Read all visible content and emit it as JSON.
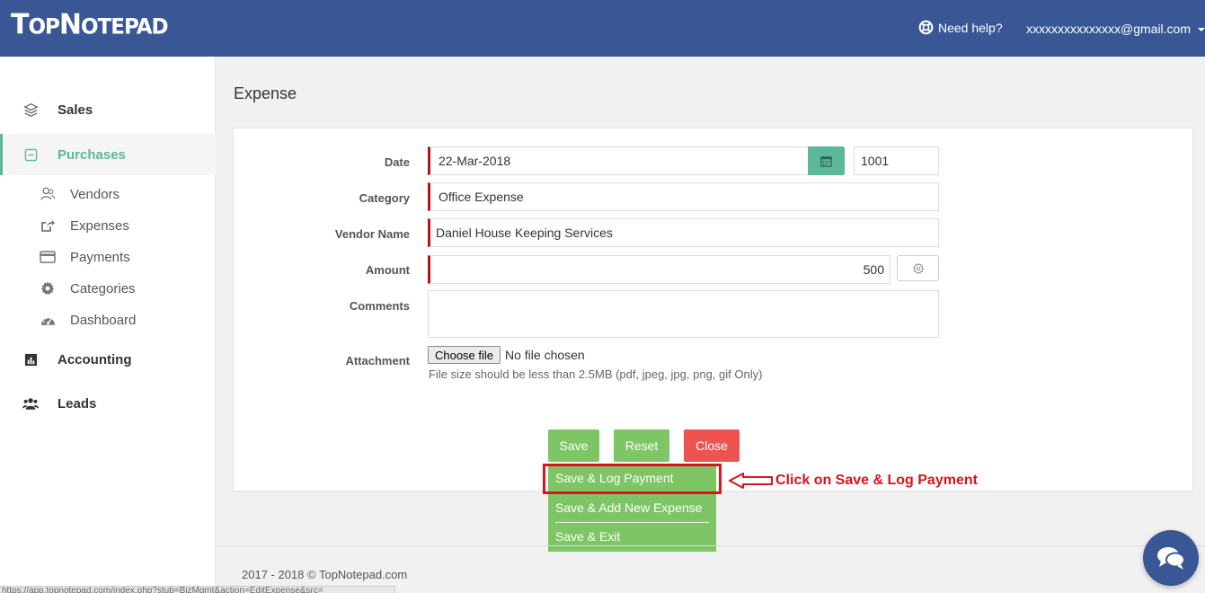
{
  "header": {
    "logo": "TopNotepad",
    "logo_parts": [
      "T",
      "OP",
      "N",
      "OTEPAD"
    ],
    "help_label": "Need help?",
    "user_email": "xxxxxxxxxxxxxxx@gmail.com"
  },
  "sidebar": {
    "sales": "Sales",
    "purchases": "Purchases",
    "sub_items": [
      "Vendors",
      "Expenses",
      "Payments",
      "Categories",
      "Dashboard"
    ],
    "accounting": "Accounting",
    "leads": "Leads"
  },
  "page": {
    "title": "Expense"
  },
  "form": {
    "date_label": "Date",
    "date_value": "22-Mar-2018",
    "number_value": "1001",
    "category_label": "Category",
    "category_value": "Office Expense",
    "vendor_label": "Vendor Name",
    "vendor_value": "Daniel House Keeping Services",
    "amount_label": "Amount",
    "amount_value": "500",
    "comments_label": "Comments",
    "comments_value": "",
    "attachment_label": "Attachment",
    "choose_file": "Choose file",
    "no_file": "No file chosen",
    "file_hint": "File size should be less than 2.5MB (pdf, jpeg, jpg, png, gif Only)"
  },
  "actions": {
    "save": "Save",
    "reset": "Reset",
    "close": "Close",
    "dropdown": [
      "Save & Log Payment",
      "Save & Add New Expense",
      "Save & Exit"
    ]
  },
  "annotation": {
    "callout": "Click on Save & Log Payment"
  },
  "footer": {
    "copyright": "2017 - 2018 © TopNotepad.com"
  },
  "statusbar": {
    "url": "https://app.topnotepad.com/index.php?stub=BizMgmt&action=EditExpense&src="
  },
  "colors": {
    "header": "#3a5795",
    "accent": "#5cb89a",
    "green": "#7dc565",
    "red": "#ef5350",
    "required": "#b3141b",
    "annotation": "#d7141c"
  }
}
